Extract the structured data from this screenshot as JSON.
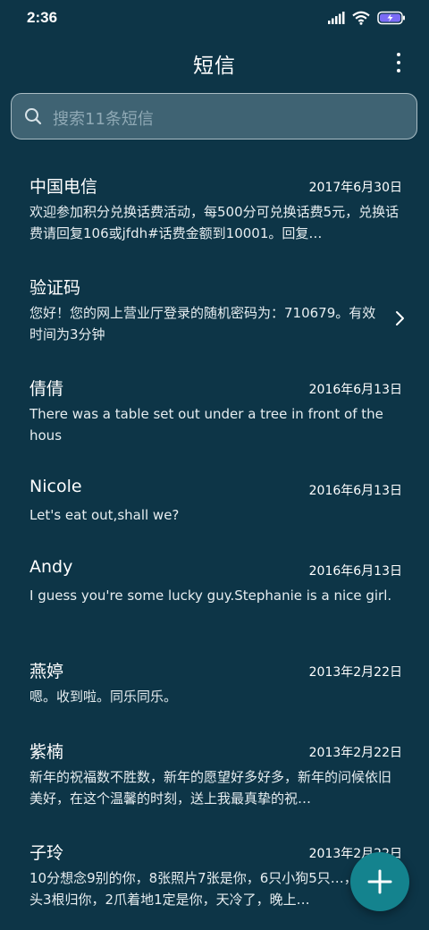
{
  "status_bar": {
    "time": "2:36",
    "icons": [
      "signal-icon",
      "wifi-icon",
      "battery-charging-icon"
    ]
  },
  "header": {
    "title": "短信",
    "more_icon": "more-vertical-icon"
  },
  "search": {
    "placeholder": "搜索11条短信",
    "icon": "search-icon"
  },
  "messages": [
    {
      "sender": "中国电信",
      "date": "2017年6月30日",
      "preview": "欢迎参加积分兑换话费活动，每500分可兑换话费5元，兑换话费请回复106或jfdh#话费金额到10001。回复…"
    },
    {
      "sender": "验证码",
      "date": "",
      "preview": "您好！您的网上营业厅登录的随机密码为：710679。有效时间为3分钟",
      "has_chevron": true
    },
    {
      "sender": "倩倩",
      "date": "2016年6月13日",
      "preview": "There was a table set out under a tree in front of the hous"
    },
    {
      "sender": "Nicole",
      "date": "2016年6月13日",
      "preview": "Let's eat out,shall we?"
    },
    {
      "sender": "Andy",
      "date": "2016年6月13日",
      "preview": "I guess you're some lucky guy.Stephanie is a nice girl."
    },
    {
      "sender": "燕婷",
      "date": "2013年2月22日",
      "preview": "嗯。收到啦。同乐同乐。"
    },
    {
      "sender": "紫楠",
      "date": "2013年2月22日",
      "preview": "新年的祝福数不胜数，新年的愿望好多好多，新年的问候依旧美好，在这个温馨的时刻，送上我最真挚的祝…"
    },
    {
      "sender": "子玲",
      "date": "2013年2月22日",
      "preview": "10分想念9别的你，8张照片7张是你，6只小狗5只…，4根骨头3根归你，2爪着地1定是你，天冷了，晚上…"
    }
  ],
  "fab": {
    "icon": "plus-icon",
    "color": "#14838e"
  },
  "colors": {
    "background": "#0d3547",
    "search_background": "#3f6373",
    "search_border": "#a9bcc4",
    "placeholder": "#8fa9b5",
    "accent": "#14838e",
    "battery": "#7b6cf6"
  }
}
